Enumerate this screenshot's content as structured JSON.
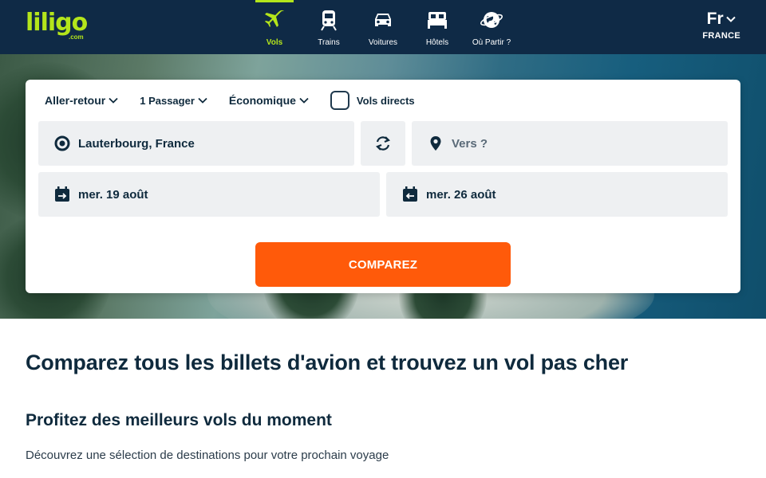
{
  "brand": {
    "logo_text": "liligo",
    "logo_suffix": ".com",
    "accent": "#b4e51b",
    "header_bg": "#0f2a46"
  },
  "nav": [
    {
      "label": "Vols",
      "icon": "plane-icon",
      "active": true
    },
    {
      "label": "Trains",
      "icon": "train-icon",
      "active": false
    },
    {
      "label": "Voitures",
      "icon": "car-icon",
      "active": false
    },
    {
      "label": "Hôtels",
      "icon": "bed-icon",
      "active": false
    },
    {
      "label": "Où Partir ?",
      "icon": "globe-icon",
      "active": false
    }
  ],
  "lang": {
    "code": "Fr",
    "country": "FRANCE"
  },
  "search": {
    "trip_type": "Aller-retour",
    "passengers": "1 Passager",
    "cabin": "Économique",
    "direct_label": "Vols directs",
    "direct_checked": false,
    "from_value": "Lauterbourg, France",
    "to_placeholder": "Vers ?",
    "depart_date": "mer. 19 août",
    "return_date": "mer. 26 août",
    "submit_label": "COMPAREZ",
    "cta_color": "#ff5a0a"
  },
  "content": {
    "heading": "Comparez tous les billets d'avion et trouvez un vol pas cher",
    "subheading": "Profitez des meilleurs vols du moment",
    "description": "Découvrez une sélection de destinations pour votre prochain voyage"
  }
}
